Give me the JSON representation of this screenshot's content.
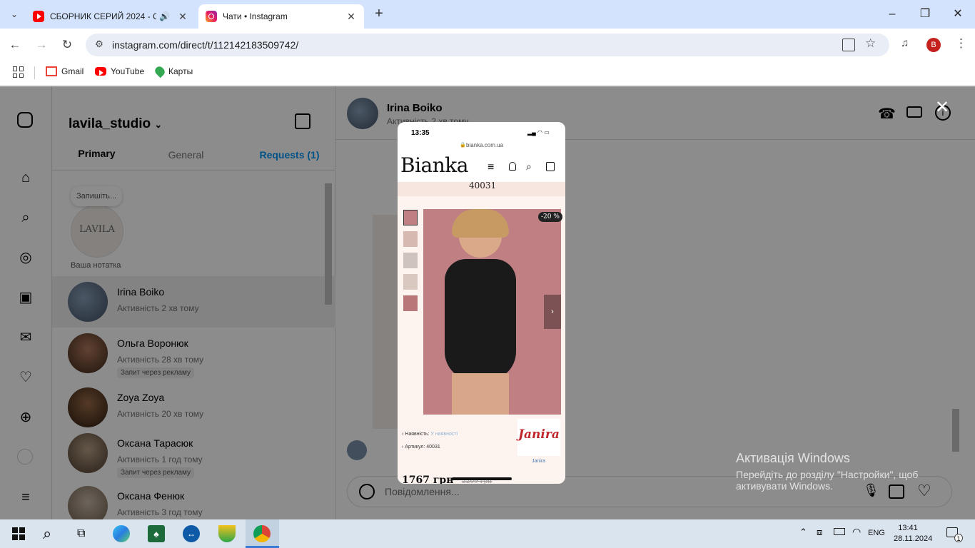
{
  "browser": {
    "tabs": [
      {
        "title": "СБОРНИК СЕРИЙ 2024 - С",
        "icon": "youtube-icon",
        "audio": true
      },
      {
        "title": "Чати • Instagram",
        "icon": "instagram-icon",
        "active": true
      }
    ],
    "url": "instagram.com/direct/t/112142183509742/",
    "profile_initial": "B",
    "bookmarks": [
      {
        "label": "Gmail",
        "icon": "gmail-icon"
      },
      {
        "label": "YouTube",
        "icon": "youtube-icon"
      },
      {
        "label": "Карты",
        "icon": "maps-icon"
      }
    ]
  },
  "instagram": {
    "account": "lavila_studio",
    "tabs": [
      "Primary",
      "General",
      "Requests (1)"
    ],
    "note": {
      "bubble": "Запишіть...",
      "label": "Ваша нотатка",
      "logo_text": "LAVILA"
    },
    "conversations": [
      {
        "name": "Irina Boiko",
        "status": "Активність 2 хв тому",
        "badge": ""
      },
      {
        "name": "Ольга Воронюк",
        "status": "Активність 28 хв тому",
        "badge": "Запит через рекламу"
      },
      {
        "name": "Zoya Zoya",
        "status": "Активність 20 хв тому",
        "badge": ""
      },
      {
        "name": "Оксана Тарасюк",
        "status": "Активність 1 год тому",
        "badge": "Запит через рекламу"
      },
      {
        "name": "Оксана Фенюк",
        "status": "Активність 3 год тому",
        "badge": ""
      }
    ],
    "chat": {
      "name": "Irina Boiko",
      "status": "Активність 2 хв тому",
      "placeholder": "Повідомлення..."
    }
  },
  "phone_screenshot": {
    "time": "13:35",
    "domain": "bianka.com.ua",
    "brand": "Bianka",
    "article_top": "40031",
    "discount": "-20 %",
    "availability_label": "Наявність:",
    "availability_value": "У наявності",
    "article_label": "Артикул: 40031",
    "brand_logo": "Janira",
    "brand_link": "Janira",
    "price": "1767 грн",
    "old_price": "2209 грн"
  },
  "windows": {
    "activation_title": "Активація Windows",
    "activation_text_1": "Перейдіть до розділу \"Настройки\", щоб",
    "activation_text_2": "активувати Windows.",
    "time": "13:41",
    "date": "28.11.2024",
    "lang": "ENG",
    "notif_count": "1"
  },
  "colors": {
    "accent": "#0095f6",
    "tabbar": "#d3e3fd",
    "phone_bg": "#fdf3ef",
    "photo_bg": "#c07f83"
  }
}
